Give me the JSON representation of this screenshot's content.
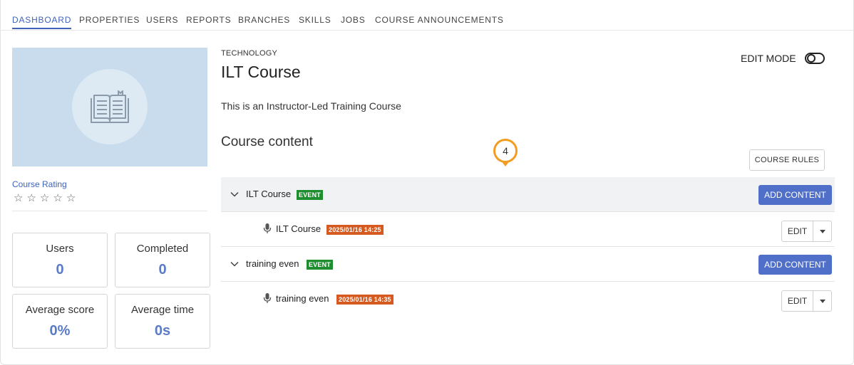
{
  "nav": {
    "tabs": [
      "DASHBOARD",
      "PROPERTIES",
      "USERS",
      "REPORTS",
      "BRANCHES",
      "SKILLS",
      "JOBS",
      "COURSE ANNOUNCEMENTS"
    ],
    "active": "DASHBOARD"
  },
  "sidebar": {
    "thumbnail_icon": "book-icon",
    "rating_label": "Course Rating",
    "rating_value": 0,
    "rating_max": 5,
    "stats": {
      "users": {
        "label": "Users",
        "value": "0"
      },
      "completed": {
        "label": "Completed",
        "value": "0"
      },
      "average_score": {
        "label": "Average score",
        "value": "0%"
      },
      "average_time": {
        "label": "Average time",
        "value": "0s"
      }
    }
  },
  "course": {
    "category": "TECHNOLOGY",
    "title": "ILT Course",
    "edit_mode_label": "EDIT MODE",
    "description": "This is an Instructor-Led Training Course",
    "content_heading": "Course content",
    "rules_button": "COURSE RULES",
    "step_marker": "4"
  },
  "units": [
    {
      "title": "ILT Course",
      "badge": "EVENT",
      "add_button": "ADD CONTENT",
      "session": {
        "title": "ILT Course",
        "date": "2025/01/16 14:25",
        "edit_label": "EDIT"
      }
    },
    {
      "title": "training even",
      "badge": "EVENT",
      "add_button": "ADD CONTENT",
      "session": {
        "title": "training even",
        "date": "2025/01/16 14:35",
        "edit_label": "EDIT"
      }
    }
  ],
  "colors": {
    "accent": "#3f63b8",
    "primary_button": "#4f6fc9",
    "event_badge": "#1e8e2e",
    "date_badge": "#d65a1f",
    "marker": "#f39c1f",
    "thumbnail_bg": "#c9dced"
  }
}
